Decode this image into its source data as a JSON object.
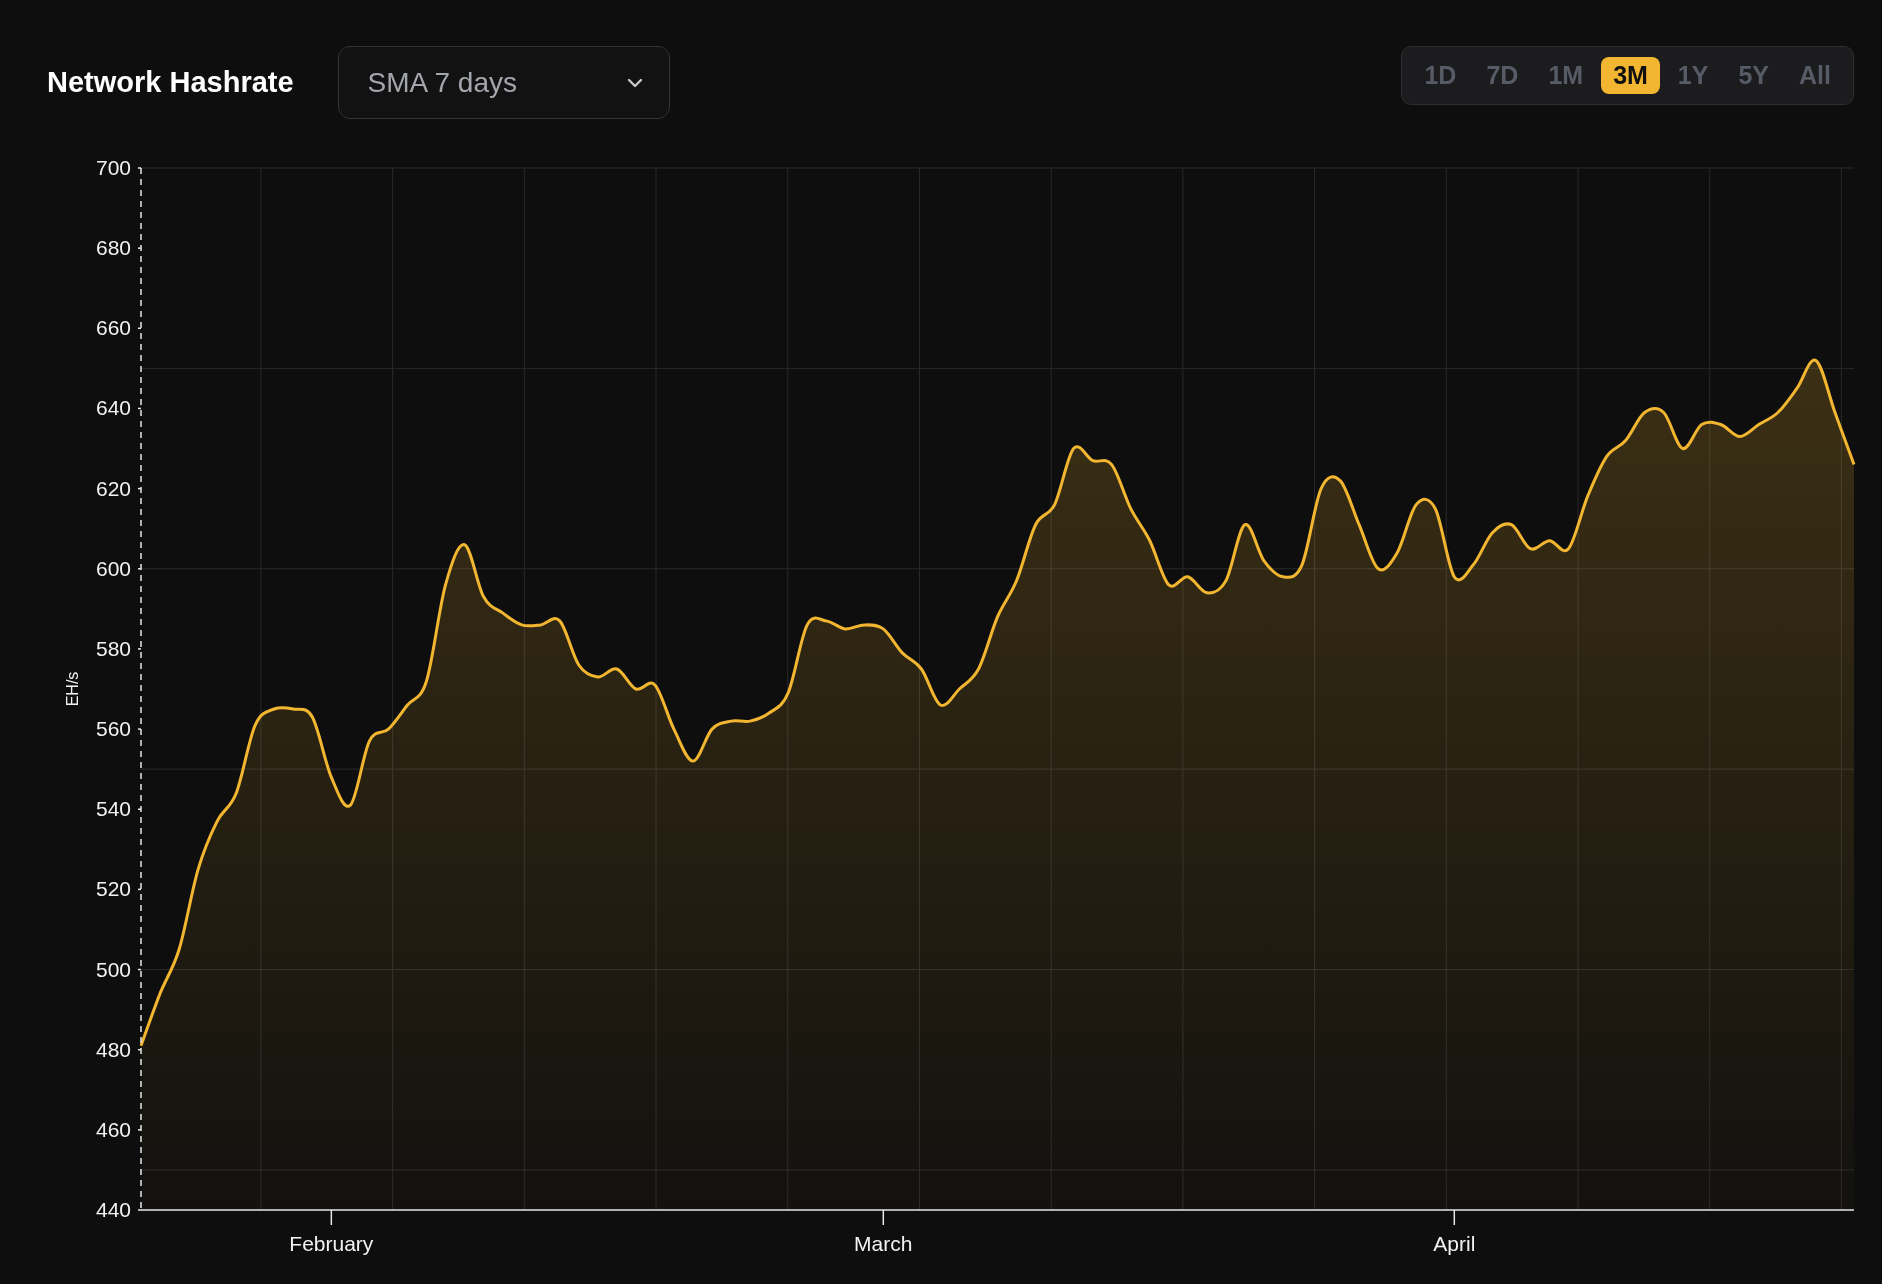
{
  "header": {
    "title": "Network Hashrate",
    "dropdown": {
      "value": "SMA 7 days"
    },
    "ranges": [
      {
        "label": "1D",
        "selected": false
      },
      {
        "label": "7D",
        "selected": false
      },
      {
        "label": "1M",
        "selected": false
      },
      {
        "label": "3M",
        "selected": true
      },
      {
        "label": "1Y",
        "selected": false
      },
      {
        "label": "5Y",
        "selected": false
      },
      {
        "label": "All",
        "selected": false
      }
    ]
  },
  "chart": {
    "chart_data": {
      "type": "area",
      "grid": true,
      "ylabel": "EH/s",
      "ylim": [
        440,
        700
      ],
      "yticks": [
        440,
        460,
        480,
        500,
        520,
        540,
        560,
        580,
        600,
        620,
        640,
        660,
        680,
        700
      ],
      "categories": [
        null,
        null,
        null,
        null,
        null,
        null,
        null,
        null,
        null,
        null,
        "February",
        null,
        null,
        null,
        null,
        null,
        null,
        null,
        null,
        null,
        null,
        null,
        null,
        null,
        null,
        null,
        null,
        null,
        null,
        null,
        null,
        null,
        null,
        null,
        null,
        null,
        null,
        null,
        null,
        "March",
        null,
        null,
        null,
        null,
        null,
        null,
        null,
        null,
        null,
        null,
        null,
        null,
        null,
        null,
        null,
        null,
        null,
        null,
        null,
        null,
        null,
        null,
        null,
        null,
        null,
        null,
        null,
        null,
        null,
        "April",
        null,
        null,
        null,
        null,
        null,
        null,
        null,
        null,
        null,
        null,
        null,
        null,
        null,
        null,
        null,
        null,
        null,
        null,
        null,
        null,
        null
      ],
      "series": [
        {
          "color": "#f2b630",
          "values": [
            481,
            494,
            505,
            525,
            537,
            544,
            561,
            565,
            565,
            563,
            548,
            541,
            557,
            560,
            566,
            572,
            596,
            606,
            593,
            589,
            586,
            586,
            587,
            576,
            573,
            575,
            570,
            571,
            560,
            552,
            560,
            562,
            562,
            564,
            569,
            586,
            587,
            585,
            586,
            585,
            579,
            575,
            566,
            570,
            575,
            588,
            597,
            611,
            616,
            630,
            627,
            626,
            615,
            607,
            596,
            598,
            594,
            597,
            611,
            602,
            598,
            601,
            620,
            622,
            611,
            600,
            604,
            616,
            615,
            598,
            601,
            609,
            611,
            605,
            607,
            605,
            618,
            628,
            632,
            639,
            639,
            630,
            636,
            636,
            633,
            636,
            639,
            645,
            652,
            639,
            626
          ]
        }
      ]
    }
  }
}
